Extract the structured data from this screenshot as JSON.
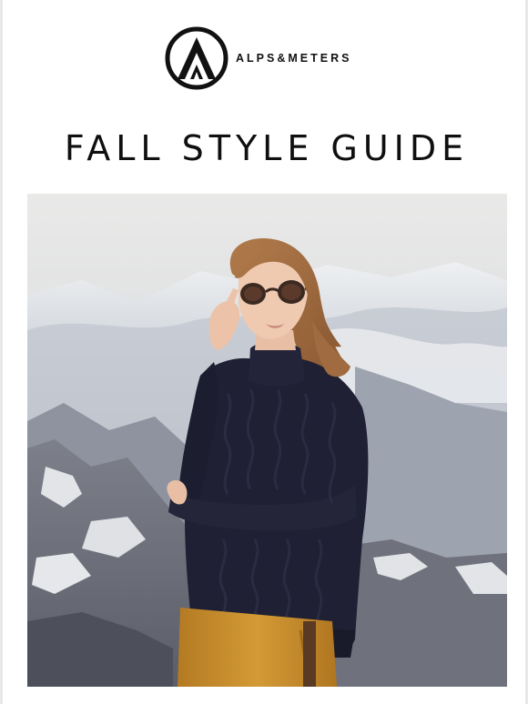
{
  "brand": {
    "name": "ALPS&METERS",
    "logo_icon": "alps-peak-logo-icon"
  },
  "headline": "FALL STYLE GUIDE",
  "hero": {
    "image": "model-in-turtleneck-sweater-mountain-photo"
  },
  "colors": {
    "text": "#0f0f0f",
    "background": "#ffffff",
    "sweater": "#1f2033",
    "trousers": "#c98d2a"
  }
}
